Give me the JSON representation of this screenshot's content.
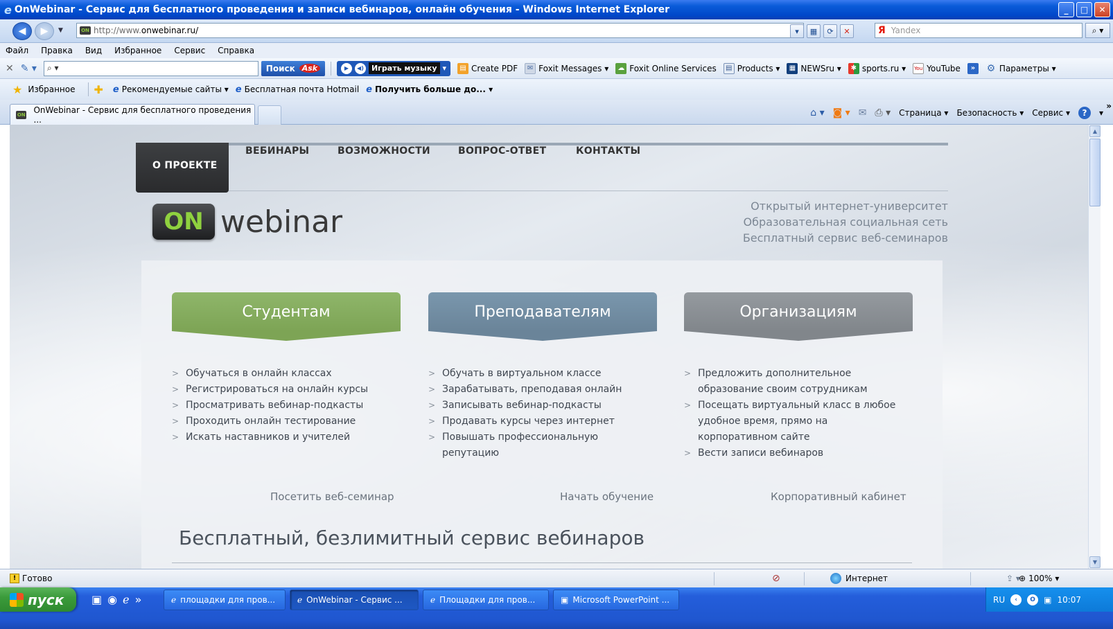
{
  "window": {
    "title": "OnWebinar - Сервис для бесплатного проведения и записи вебинаров, онлайн обучения - Windows Internet Explorer",
    "min_glyph": "_",
    "max_glyph": "□",
    "close_glyph": "✕"
  },
  "address": {
    "url_prefix": "http://www.",
    "url_domain": "onwebinar.ru/",
    "site_icon_text": "ON",
    "search_engine": "Я",
    "search_placeholder": "Yandex"
  },
  "menubar": [
    "Файл",
    "Правка",
    "Вид",
    "Избранное",
    "Сервис",
    "Справка"
  ],
  "toolbar": {
    "close": "✕",
    "search_button": "Поиск",
    "ask_logo": "Ask",
    "music_button": "Играть музыку",
    "items": [
      {
        "icon": "pdf-icon",
        "glyph": "▤",
        "label": "Create PDF"
      },
      {
        "icon": "foxit-messages-icon",
        "glyph": "✉",
        "label": "Foxit Messages ▾"
      },
      {
        "icon": "foxit-online-icon",
        "glyph": "☁",
        "label": "Foxit Online Services"
      },
      {
        "icon": "products-icon",
        "glyph": "▤",
        "label": "Products ▾"
      },
      {
        "icon": "newsru-icon",
        "glyph": "▦",
        "label": "NEWSru ▾"
      },
      {
        "icon": "sports-icon",
        "glyph": "✱",
        "label": "sports.ru ▾"
      },
      {
        "icon": "youtube-icon",
        "glyph": "You",
        "label": "YouTube"
      }
    ],
    "more": "»",
    "settings": "Параметры ▾"
  },
  "favorites": {
    "label": "Избранное",
    "items": [
      "Рекомендуемые сайты ▾",
      "Бесплатная почта Hotmail",
      "Получить больше до... ▾"
    ]
  },
  "tabs": {
    "active_tab": "OnWebinar - Сервис для бесплатного проведения ...",
    "commands": [
      "Страница ▾",
      "Безопасность ▾",
      "Сервис ▾"
    ],
    "help": "?",
    "overflow": "»"
  },
  "site": {
    "nav": [
      "О ПРОЕКТЕ",
      "ВЕБИНАРЫ",
      "ВОЗМОЖНОСТИ",
      "ВОПРОС-ОТВЕТ",
      "КОНТАКТЫ"
    ],
    "logo_on": "ON",
    "logo_text": "webinar",
    "taglines": [
      "Открытый интернет-университет",
      "Образовательная социальная сеть",
      "Бесплатный сервис веб-семинаров"
    ],
    "ctas": [
      "Студентам",
      "Преподавателям",
      "Организациям"
    ],
    "students": [
      "Обучаться в онлайн классах",
      "Регистрироваться на онлайн курсы",
      "Просматривать вебинар-подкасты",
      "Проходить онлайн тестирование",
      "Искать наставников и учителей"
    ],
    "teachers": [
      "Обучать в виртуальном классе",
      "Зарабатывать, преподавая онлайн",
      "Записывать вебинар-подкасты",
      "Продавать курсы через интернет",
      "Повышать профессиональную репутацию"
    ],
    "orgs": [
      "Предложить дополнительное образование своим сотрудникам",
      "Посещать виртуальный класс в любое удобное время, прямо на корпоративном сайте",
      "Вести записи вебинаров"
    ],
    "links": [
      "Посетить веб-семинар",
      "Начать обучение",
      "Корпоративный кабинет"
    ],
    "heading": "Бесплатный, безлимитный сервис вебинаров"
  },
  "status": {
    "text": "Готово",
    "zone": "Интернет",
    "zoom": "100%"
  },
  "taskbar": {
    "start": "пуск",
    "tasks": [
      "площадки для пров...",
      "OnWebinar - Сервис ...",
      "Площадки для пров...",
      "Microsoft PowerPoint ..."
    ],
    "lang": "RU",
    "time": "10:07"
  }
}
